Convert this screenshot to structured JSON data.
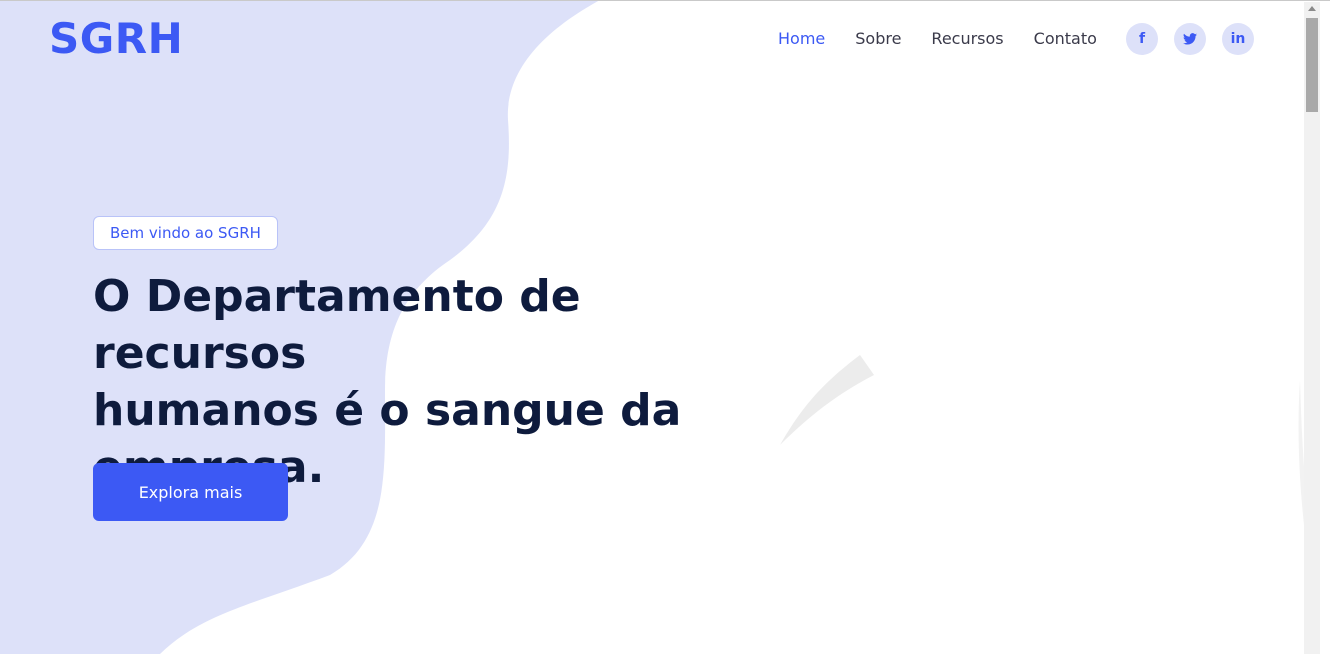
{
  "brand": {
    "logo": "SGRH",
    "accent_color": "#3c59f4",
    "blob_color": "#dde1f9"
  },
  "nav": {
    "items": [
      {
        "label": "Home",
        "active": true
      },
      {
        "label": "Sobre",
        "active": false
      },
      {
        "label": "Recursos",
        "active": false
      },
      {
        "label": "Contato",
        "active": false
      }
    ]
  },
  "social": [
    {
      "icon": "facebook-icon",
      "glyph": "f"
    },
    {
      "icon": "twitter-icon",
      "glyph": "t"
    },
    {
      "icon": "linkedin-icon",
      "glyph": "in"
    }
  ],
  "hero": {
    "badge": "Bem vindo ao SGRH",
    "headline_lines": [
      "O Departamento de recursos",
      "humanos é o sangue da",
      "empresa."
    ],
    "cta_label": "Explora mais"
  }
}
